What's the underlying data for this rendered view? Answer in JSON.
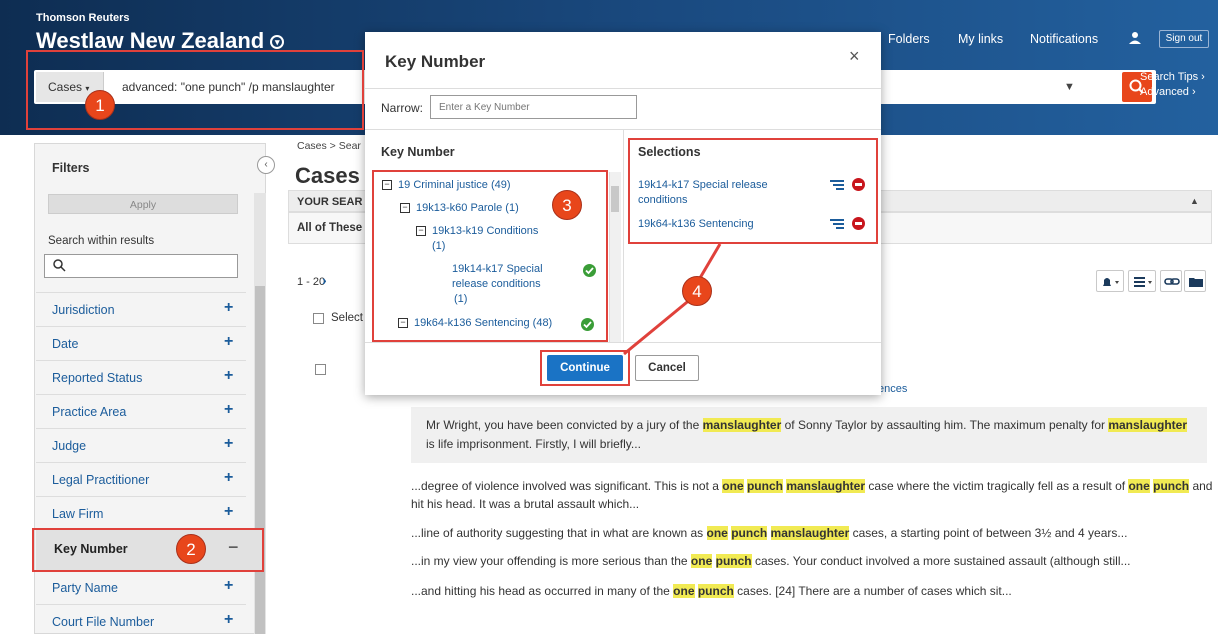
{
  "header": {
    "brand_top": "Thomson Reuters",
    "brand": "Westlaw New Zealand",
    "nav": [
      "Folders",
      "My links",
      "Notifications"
    ],
    "signout": "Sign out",
    "search_scope": "Cases",
    "query": "advanced: \"one punch\" /p manslaughter",
    "search_tips": "Search Tips ›",
    "advanced": "Advanced ›"
  },
  "sidebar": {
    "title": "Filters",
    "apply": "Apply",
    "search_within_label": "Search within results",
    "filters": [
      "Jurisdiction",
      "Date",
      "Reported Status",
      "Practice Area",
      "Judge",
      "Legal Practitioner",
      "Law Firm"
    ],
    "key_number": "Key Number",
    "filters_after": [
      "Party Name",
      "Court File Number"
    ]
  },
  "main": {
    "breadcrumb": "Cases > Sear",
    "title": "Cases (",
    "your_search": "YOUR SEAR",
    "all_of_these": "All of These",
    "pager": "1 - 20",
    "select_all": "Select",
    "result_link_fragment": "ences",
    "snippet1": {
      "a": "Mr Wright, you have been convicted by a jury of the ",
      "b": "manslaughter",
      "c": " of Sonny Taylor by assaulting him. The maximum penalty for ",
      "d": "manslaughter",
      "e": "is life imprisonment. Firstly, I will briefly..."
    },
    "snippet2": {
      "a": "...degree of violence involved was significant. This is not a ",
      "b": "one",
      "c": "punch",
      "d": "manslaughter",
      "e": " case where the victim tragically fell as a result of ",
      "f": "one",
      "g": "punch",
      "h": " and",
      "i": "hit his head. It was a brutal assault which..."
    },
    "snippet3": {
      "a": "...line of authority suggesting that in what are known as ",
      "b": "one",
      "c": "punch",
      "d": "manslaughter",
      "e": " cases, a starting point of between 3½ and 4 years..."
    },
    "snippet4": {
      "a": "...in my view your offending is more serious than the ",
      "b": "one",
      "c": "punch",
      "d": " cases. Your conduct involved a more sustained assault (although still..."
    },
    "snippet5": {
      "a": "...and hitting his head as occurred in many of the ",
      "b": "one",
      "c": "punch",
      "d": " cases. [24] There are a number of cases which sit..."
    }
  },
  "dialog": {
    "title": "Key Number",
    "close": "×",
    "narrow_label": "Narrow:",
    "narrow_placeholder": "Enter a Key Number",
    "key_number_heading": "Key Number",
    "selections_heading": "Selections",
    "tree": [
      {
        "toggle": "−",
        "code": "19",
        "text": "Criminal justice (49)"
      },
      {
        "toggle": "−",
        "code": "19k13-k60",
        "text": "Parole (1)"
      },
      {
        "toggle": "−",
        "code": "19k13-k19",
        "text": "Conditions",
        "extra": "(1)"
      },
      {
        "code": "19k14-k17",
        "text": "Special",
        "extra": "release conditions",
        "extra2": "(1)"
      },
      {
        "toggle": "−",
        "code": "19k64-k136",
        "text": "Sentencing (48)"
      }
    ],
    "selections": [
      {
        "code": "19k14-k17",
        "text": "Special release",
        "extra": "conditions"
      },
      {
        "code": "19k64-k136",
        "text": "Sentencing"
      }
    ],
    "continue": "Continue",
    "cancel": "Cancel"
  },
  "annotations": [
    "1",
    "2",
    "3",
    "4"
  ],
  "colors": {
    "header_dark": "#0e2d52",
    "link": "#1b5c9b",
    "accent_orange": "#e8461b",
    "annotation_red": "#e0413b",
    "continue_blue": "#1a73c5",
    "check_green": "#3a9d37",
    "remove_red": "#c8161d",
    "highlight": "#f1ea53"
  }
}
